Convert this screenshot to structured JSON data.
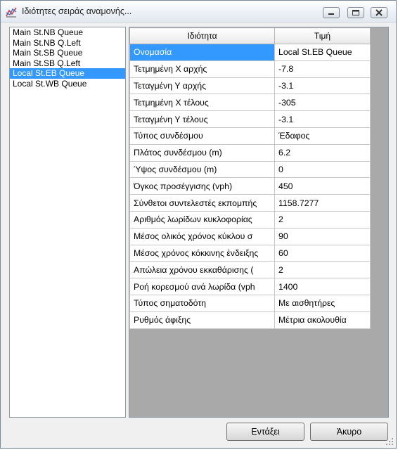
{
  "window": {
    "title": "Ιδιότητες σειράς αναμονής..."
  },
  "queues": [
    {
      "label": "Main St.NB Queue",
      "selected": false
    },
    {
      "label": "Main St.NB Q.Left",
      "selected": false
    },
    {
      "label": "Main St.SB Queue",
      "selected": false
    },
    {
      "label": "Main St.SB Q.Left",
      "selected": false
    },
    {
      "label": "Local St.EB Queue",
      "selected": true
    },
    {
      "label": "Local St.WB Queue",
      "selected": false
    }
  ],
  "grid": {
    "headers": {
      "property": "Ιδιότητα",
      "value": "Τιμή"
    },
    "rows": [
      {
        "property": "Ονομασία",
        "value": "Local St.EB Queue",
        "selected": true
      },
      {
        "property": "Τετμημένη Χ αρχής",
        "value": "-7.8"
      },
      {
        "property": "Τεταγμένη Υ αρχής",
        "value": "-3.1"
      },
      {
        "property": "Τετμημένη Χ τέλους",
        "value": "-305"
      },
      {
        "property": "Τεταγμένη Υ τέλους",
        "value": "-3.1"
      },
      {
        "property": "Τύπος συνδέσμου",
        "value": "Έδαφος"
      },
      {
        "property": "Πλάτος συνδέσμου (m)",
        "value": "6.2"
      },
      {
        "property": "Ύψος συνδέσμου (m)",
        "value": "0"
      },
      {
        "property": "Όγκος προσέγγισης (vph)",
        "value": "450"
      },
      {
        "property": "Σύνθετοι συντελεστές εκπομπής",
        "value": "1158.7277"
      },
      {
        "property": "Αριθμός λωρίδων κυκλοφορίας",
        "value": "2"
      },
      {
        "property": "Μέσος ολικός χρόνος κύκλου σ",
        "value": "90"
      },
      {
        "property": "Μέσος χρόνος κόκκινης ένδειξης",
        "value": "60"
      },
      {
        "property": "Απώλεια χρόνου εκκαθάρισης (",
        "value": "2"
      },
      {
        "property": "Ροή κορεσμού ανά λωρίδα (vph",
        "value": "1400"
      },
      {
        "property": "Τύπος σηματοδότη",
        "value": "Με αισθητήρες"
      },
      {
        "property": "Ρυθμός άφιξης",
        "value": "Μέτρια ακολουθία"
      }
    ]
  },
  "buttons": {
    "ok": "Εντάξει",
    "cancel": "Άκυρο"
  },
  "colors": {
    "selection": "#3399ff",
    "grid_background": "#a9a9a9"
  }
}
